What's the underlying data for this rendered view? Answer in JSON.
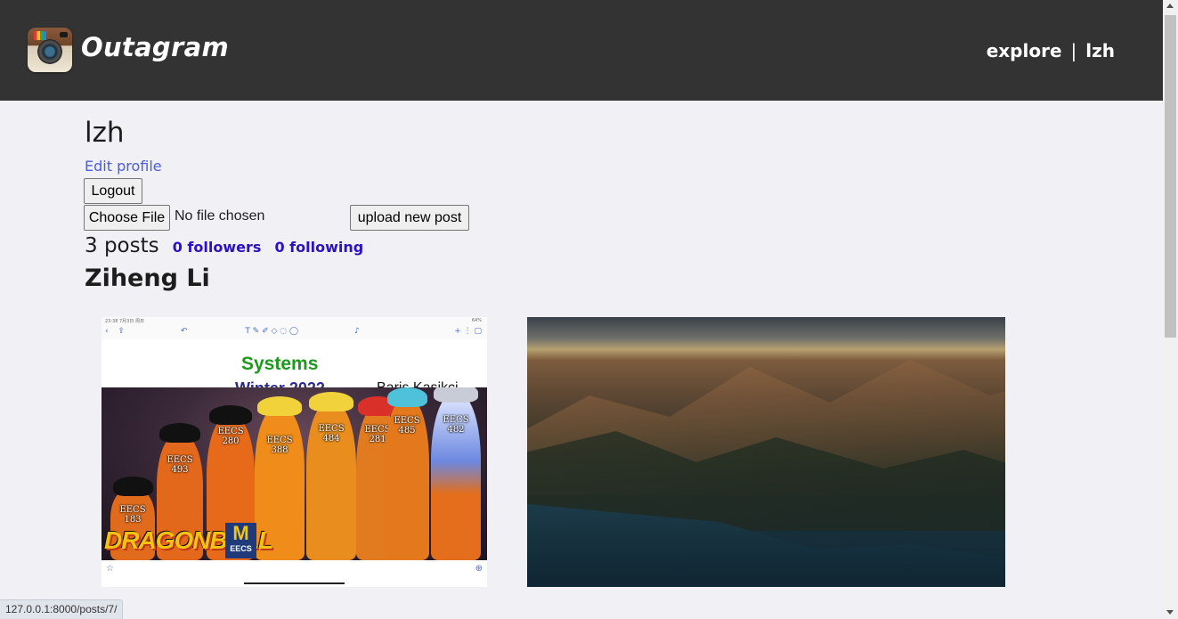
{
  "header": {
    "brand": "Outagram",
    "nav": {
      "explore": "explore",
      "separator": "|",
      "user": "lzh"
    }
  },
  "profile": {
    "username": "lzh",
    "edit_profile": "Edit profile",
    "logout": "Logout",
    "file_input": {
      "button": "Choose File",
      "status": "No file chosen"
    },
    "upload": "upload new post",
    "posts_count": "3 posts",
    "followers": "0 followers",
    "following": "0 following",
    "fullname": "Ziheng Li"
  },
  "posts": [
    {
      "kind": "screenshot-slide",
      "toolbar_time": "23:38  7月3日 周日",
      "toolbar_battery": "64%",
      "title_line": "Systems",
      "subtitle": "Winter 2022",
      "author": "Baris Kasikci",
      "figures": [
        {
          "label": "EECS\n183"
        },
        {
          "label": "EECS\n493"
        },
        {
          "label": "EECS\n280"
        },
        {
          "label": "EECS\n388"
        },
        {
          "label": "EECS\n484"
        },
        {
          "label": "EECS\n281"
        },
        {
          "label": "EECS\n485"
        },
        {
          "label": "EECS\n482"
        }
      ],
      "logo_text": "DRAGONBALL",
      "m_logo": {
        "letter": "M",
        "sub": "EECS"
      }
    },
    {
      "kind": "landscape-photo"
    }
  ],
  "statusbar": {
    "url": "127.0.0.1:8000/posts/7/"
  },
  "colors": {
    "header_bg": "#333333",
    "page_bg": "#f0f0f5",
    "link_blue": "#4a5ce0",
    "stat_purple": "#2b11c9"
  }
}
